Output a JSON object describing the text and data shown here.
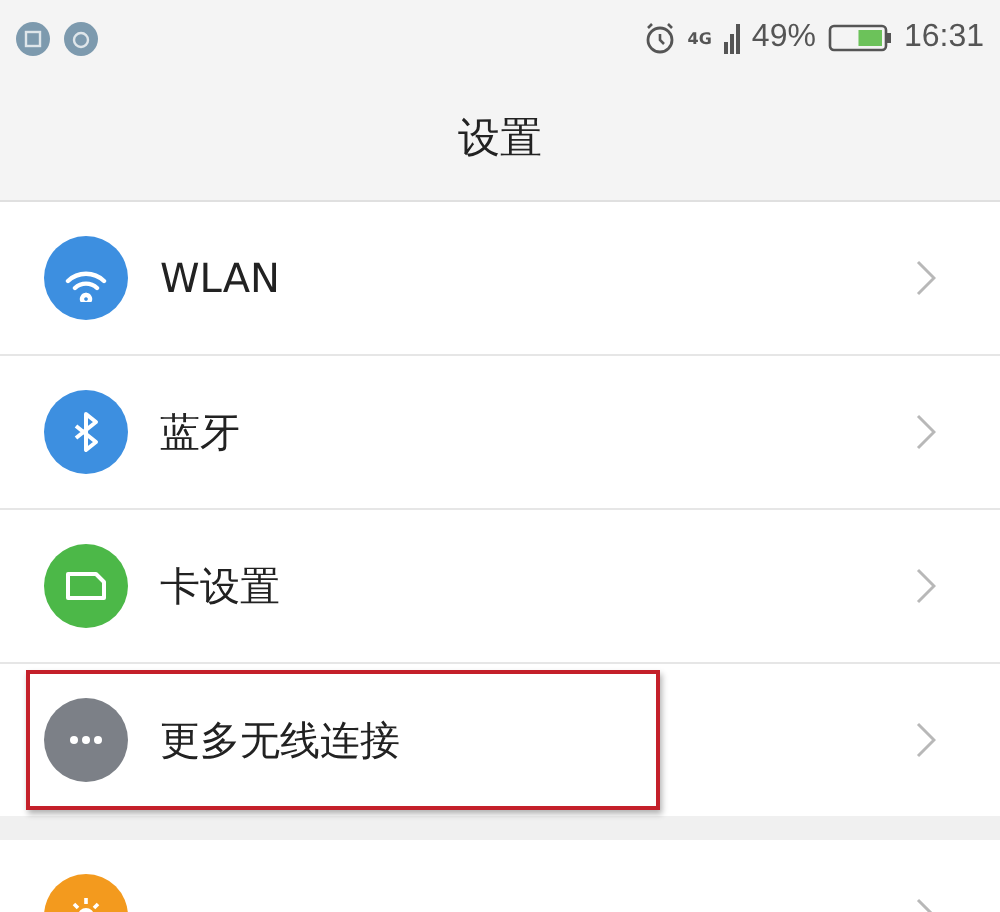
{
  "status_bar": {
    "battery": "49%",
    "time": "16:31",
    "network": "4G"
  },
  "header": {
    "title": "设置"
  },
  "groups": [
    {
      "items": [
        {
          "kind": "wifi",
          "label": "WLAN",
          "color": "#3d8fe0",
          "highlighted": false
        },
        {
          "kind": "bluetooth",
          "label": "蓝牙",
          "color": "#3d8fe0",
          "highlighted": false
        },
        {
          "kind": "sim",
          "label": "卡设置",
          "color": "#4cb848",
          "highlighted": false
        },
        {
          "kind": "more",
          "label": "更多无线连接",
          "color": "#7c8087",
          "highlighted": true
        }
      ]
    },
    {
      "items": [
        {
          "kind": "sun",
          "color": "#f39a1e",
          "highlighted": false
        }
      ]
    }
  ]
}
